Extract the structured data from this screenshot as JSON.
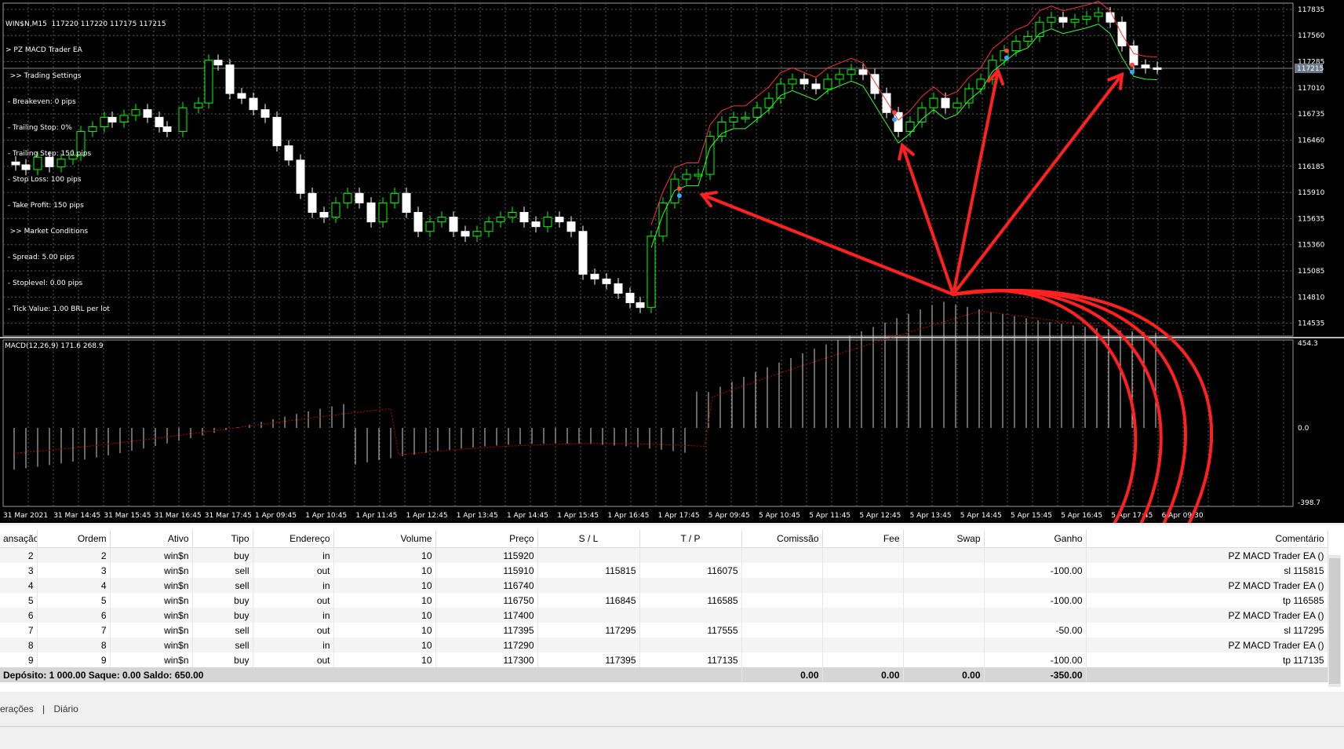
{
  "chart": {
    "info_lines": [
      "WIN$N,M15  117220 117220 117175 117215",
      "> PZ MACD Trader EA",
      "  >> Trading Settings",
      " - Breakeven: 0 pips",
      " - Trailing Stop: 0%",
      " - Trailing Step: 150 pips",
      " - Stop Loss: 100 pips",
      " - Take Profit: 150 pips",
      "  >> Market Conditions",
      " - Spread: 5.00 pips",
      " - Stoplevel: 0.00 pips",
      " - Tick Value: 1.00 BRL per lot"
    ],
    "price_ticks": [
      "117835",
      "117560",
      "117285",
      "117010",
      "116735",
      "116460",
      "116185",
      "115910",
      "115635",
      "115360",
      "115085",
      "114810",
      "114535"
    ],
    "current_price": "117215",
    "macd_label": "MACD(12,26,9) 171.6 268.9",
    "macd_ticks": [
      "454.3",
      "0.0",
      "-398.7"
    ],
    "time_ticks": [
      "31 Mar 2021",
      "31 Mar 14:45",
      "31 Mar 15:45",
      "31 Mar 16:45",
      "31 Mar 17:45",
      "1 Apr 09:45",
      "1 Apr 10:45",
      "1 Apr 11:45",
      "1 Apr 12:45",
      "1 Apr 13:45",
      "1 Apr 14:45",
      "1 Apr 15:45",
      "1 Apr 16:45",
      "1 Apr 17:45",
      "5 Apr 09:45",
      "5 Apr 10:45",
      "5 Apr 11:45",
      "5 Apr 12:45",
      "5 Apr 13:45",
      "5 Apr 14:45",
      "5 Apr 15:45",
      "5 Apr 16:45",
      "5 Apr 17:45",
      "6 Apr 09:30"
    ],
    "colors": {
      "background": "#000000",
      "bull": "#00ff00",
      "bear": "#ffffff",
      "grid": "#5a5a5a",
      "arrow": "#ff2020",
      "signal": "#c00000"
    }
  },
  "table": {
    "headers": [
      "ansação",
      "Ordem",
      "Ativo",
      "Tipo",
      "Endereço",
      "Volume",
      "Preço",
      "S / L",
      "T / P",
      "Comissão",
      "Fee",
      "Swap",
      "Ganho",
      "Comentário"
    ],
    "rows": [
      [
        "2",
        "2",
        "win$n",
        "buy",
        "in",
        "10",
        "115920",
        "",
        "",
        "",
        "",
        "",
        "",
        "PZ MACD Trader EA ()"
      ],
      [
        "3",
        "3",
        "win$n",
        "sell",
        "out",
        "10",
        "115910",
        "115815",
        "116075",
        "",
        "",
        "",
        "-100.00",
        "sl 115815"
      ],
      [
        "4",
        "4",
        "win$n",
        "sell",
        "in",
        "10",
        "116740",
        "",
        "",
        "",
        "",
        "",
        "",
        "PZ MACD Trader EA ()"
      ],
      [
        "5",
        "5",
        "win$n",
        "buy",
        "out",
        "10",
        "116750",
        "116845",
        "116585",
        "",
        "",
        "",
        "-100.00",
        "tp 116585"
      ],
      [
        "6",
        "6",
        "win$n",
        "buy",
        "in",
        "10",
        "117400",
        "",
        "",
        "",
        "",
        "",
        "",
        "PZ MACD Trader EA ()"
      ],
      [
        "7",
        "7",
        "win$n",
        "sell",
        "out",
        "10",
        "117395",
        "117295",
        "117555",
        "",
        "",
        "",
        "-50.00",
        "sl 117295"
      ],
      [
        "8",
        "8",
        "win$n",
        "sell",
        "in",
        "10",
        "117290",
        "",
        "",
        "",
        "",
        "",
        "",
        "PZ MACD Trader EA ()"
      ],
      [
        "9",
        "9",
        "win$n",
        "buy",
        "out",
        "10",
        "117300",
        "117395",
        "117135",
        "",
        "",
        "",
        "-100.00",
        "tp 117135"
      ]
    ],
    "summary": {
      "text": "Depósito: 1 000.00  Saque: 0.00  Saldo: 650.00",
      "comissao": "0.00",
      "fee": "0.00",
      "swap": "0.00",
      "ganho": "-350.00"
    }
  },
  "tabs": [
    "erações",
    "Diário"
  ]
}
